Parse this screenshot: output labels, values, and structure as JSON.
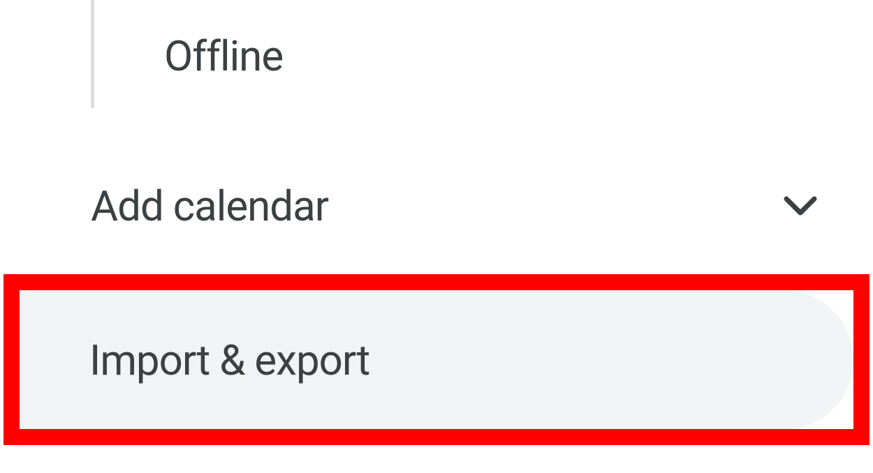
{
  "sidebar": {
    "offline_label": "Offline",
    "add_calendar_label": "Add calendar",
    "import_export_label": "Import & export"
  }
}
